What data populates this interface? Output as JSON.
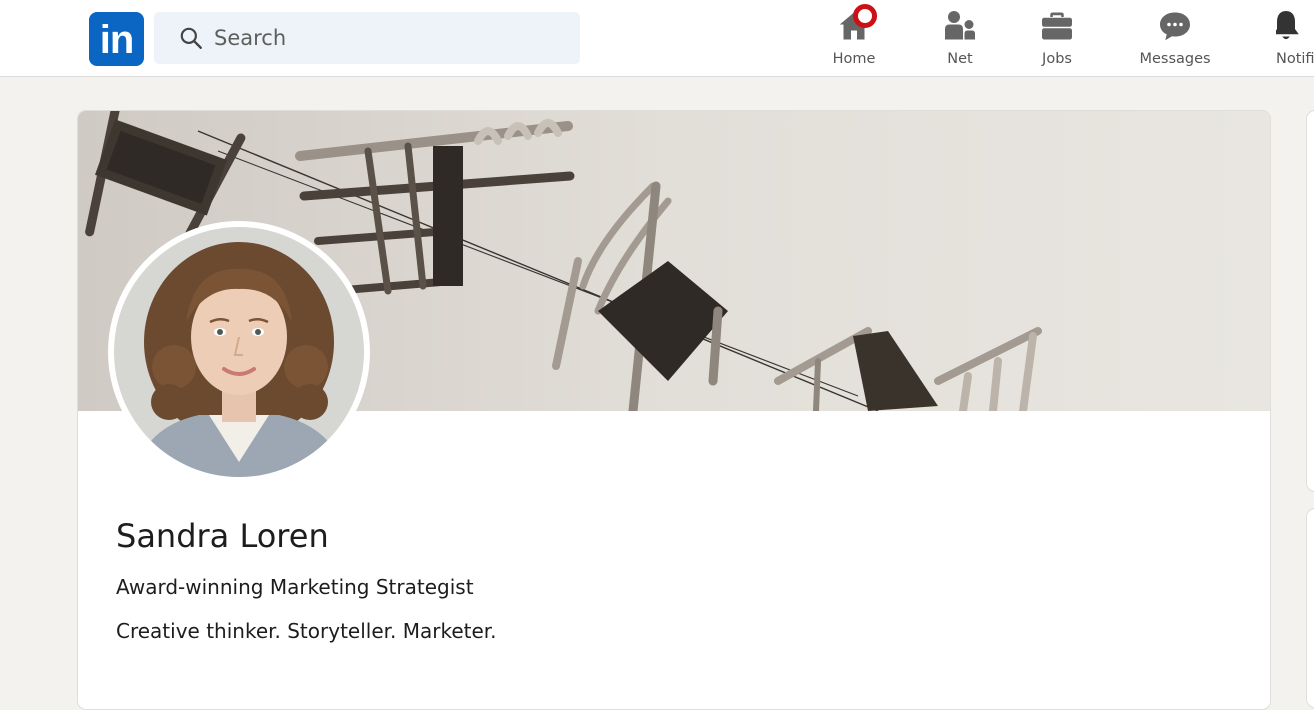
{
  "nav": {
    "logo_text": "in",
    "search": {
      "placeholder": "Search",
      "value": ""
    },
    "items": [
      {
        "label": "Home",
        "icon": "home-icon",
        "has_badge": true
      },
      {
        "label": "Net",
        "icon": "network-icon"
      },
      {
        "label": "Jobs",
        "icon": "briefcase-icon"
      },
      {
        "label": "Messages",
        "icon": "messages-icon"
      },
      {
        "label": "Notifi",
        "icon": "bell-icon"
      }
    ]
  },
  "profile": {
    "name": "Sandra Loren",
    "headline": "Award-winning Marketing Strategist",
    "tagline": "Creative thinker. Storyteller. Marketer."
  },
  "colors": {
    "brand": "#0a66c2",
    "badge": "#cc1016",
    "page_bg": "#f3f2ef"
  }
}
